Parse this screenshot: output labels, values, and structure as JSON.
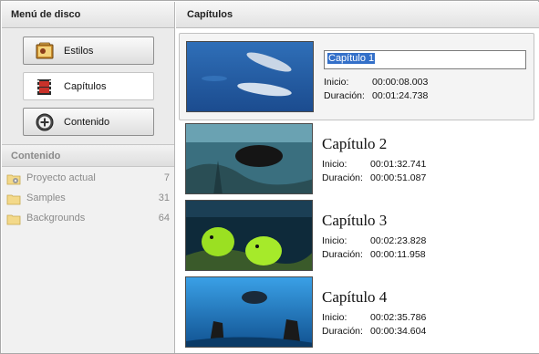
{
  "sidebar": {
    "title": "Menú de disco",
    "buttons": [
      {
        "label": "Estilos",
        "icon": "styles-icon"
      },
      {
        "label": "Capítulos",
        "icon": "chapters-film-icon"
      },
      {
        "label": "Contenido",
        "icon": "add-content-icon"
      }
    ],
    "content_title": "Contenido",
    "folders": [
      {
        "name": "Proyecto actual",
        "count": "7",
        "icon": "project-folder-icon"
      },
      {
        "name": "Samples",
        "count": "31",
        "icon": "folder-icon"
      },
      {
        "name": "Backgrounds",
        "count": "64",
        "icon": "folder-icon"
      }
    ]
  },
  "main": {
    "title": "Capítulos",
    "start_label": "Inicio:",
    "duration_label": "Duración:",
    "chapters": [
      {
        "title": "Capítulo 1",
        "start": "00:00:08.003",
        "duration": "00:01:24.738",
        "thumbnail": "dolphins-underwater"
      },
      {
        "title": "Capítulo 2",
        "start": "00:01:32.741",
        "duration": "00:00:51.087",
        "thumbnail": "reef-fish-dark"
      },
      {
        "title": "Capítulo 3",
        "start": "00:02:23.828",
        "duration": "00:00:11.958",
        "thumbnail": "yellow-fish-reef"
      },
      {
        "title": "Capítulo 4",
        "start": "00:02:35.786",
        "duration": "00:00:34.604",
        "thumbnail": "divers-blue"
      }
    ]
  }
}
